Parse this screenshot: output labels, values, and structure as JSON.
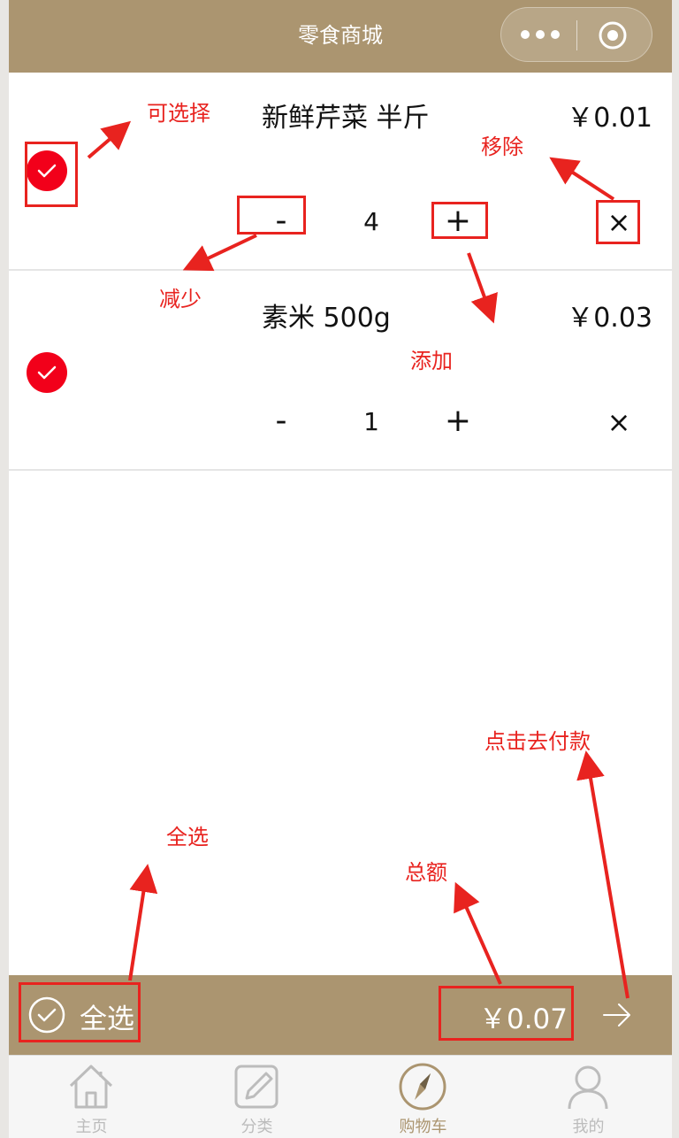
{
  "app": {
    "title": "零食商城"
  },
  "cart": {
    "items": [
      {
        "name": "新鲜芹菜 半斤",
        "price": "￥0.01",
        "quantity": "4",
        "minus": "-",
        "plus": "+",
        "remove": "×"
      },
      {
        "name": "素米 500g",
        "price": "￥0.03",
        "quantity": "1",
        "minus": "-",
        "plus": "+",
        "remove": "×"
      }
    ]
  },
  "footer": {
    "select_all": "全选",
    "total": "￥0.07"
  },
  "tabbar": {
    "tabs": [
      {
        "label": "主页",
        "icon": "home-icon"
      },
      {
        "label": "分类",
        "icon": "edit-icon"
      },
      {
        "label": "购物车",
        "icon": "compass-icon",
        "active": true
      },
      {
        "label": "我的",
        "icon": "user-icon"
      }
    ]
  },
  "annotations": {
    "selectable": "可选择",
    "remove": "移除",
    "decrease": "减少",
    "add": "添加",
    "checkout": "点击去付款",
    "select_all": "全选",
    "total": "总额"
  },
  "colors": {
    "brand": "#ab9570",
    "check_red": "#f2001a",
    "annotation_red": "#e8231f"
  }
}
